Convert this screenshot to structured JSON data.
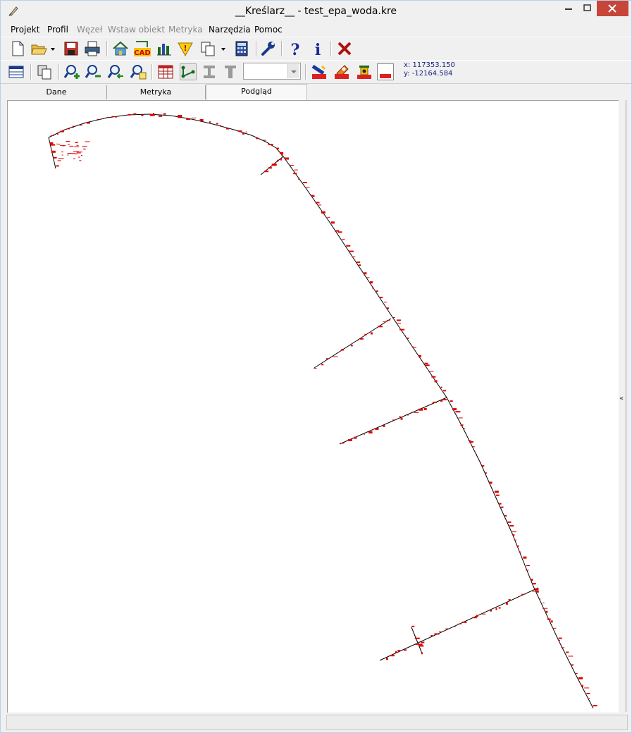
{
  "window": {
    "title": "__Kreślarz__ - test_epa_woda.kre"
  },
  "menu": [
    {
      "label": "Projekt",
      "underline": "P",
      "disabled": false
    },
    {
      "label": "Profil",
      "underline": "P",
      "disabled": false
    },
    {
      "label": "Węzeł",
      "underline": "W",
      "disabled": true
    },
    {
      "label": "Wstaw obiekt",
      "underline": "o",
      "disabled": true
    },
    {
      "label": "Metryka",
      "underline": "M",
      "disabled": true
    },
    {
      "label": "Narzędzia",
      "underline": "N",
      "disabled": false
    },
    {
      "label": "Pomoc",
      "underline": "c",
      "disabled": false
    }
  ],
  "toolbar1": {
    "icons": [
      "new-file-icon",
      "open-folder-icon",
      "save-icon",
      "print-icon",
      "house-icon",
      "cad-icon",
      "bar-chart-icon",
      "warning-icon",
      "copy-icon",
      "calculator-icon",
      "wrench-icon",
      "help-icon",
      "info-icon",
      "close-x-icon"
    ],
    "cad_label": "CAD"
  },
  "toolbar2": {
    "icons": [
      "table-view-icon",
      "window-copy-icon",
      "zoom-in-icon",
      "zoom-out-icon",
      "zoom-back-icon",
      "zoom-extent-icon",
      "grid-table-icon",
      "polyline-icon",
      "beam-icon",
      "column-icon",
      "pipe-icon",
      "valve-icon",
      "hydrant-icon",
      "color-box-icon"
    ],
    "combo_value": ""
  },
  "coords": {
    "x_text": "x: 117353.150",
    "y_text": "y: -12164.584"
  },
  "tabs": [
    {
      "label": "Dane",
      "active": false
    },
    {
      "label": "Metryka",
      "active": false
    },
    {
      "label": "Podgląd",
      "active": true
    }
  ],
  "splitter": {
    "glyph": "«"
  },
  "status": {
    "text": ""
  },
  "colors": {
    "pipe_line": "#000000",
    "annotation": "#e00000",
    "close_button": "#c7463a",
    "coords_text": "#1a237e"
  }
}
